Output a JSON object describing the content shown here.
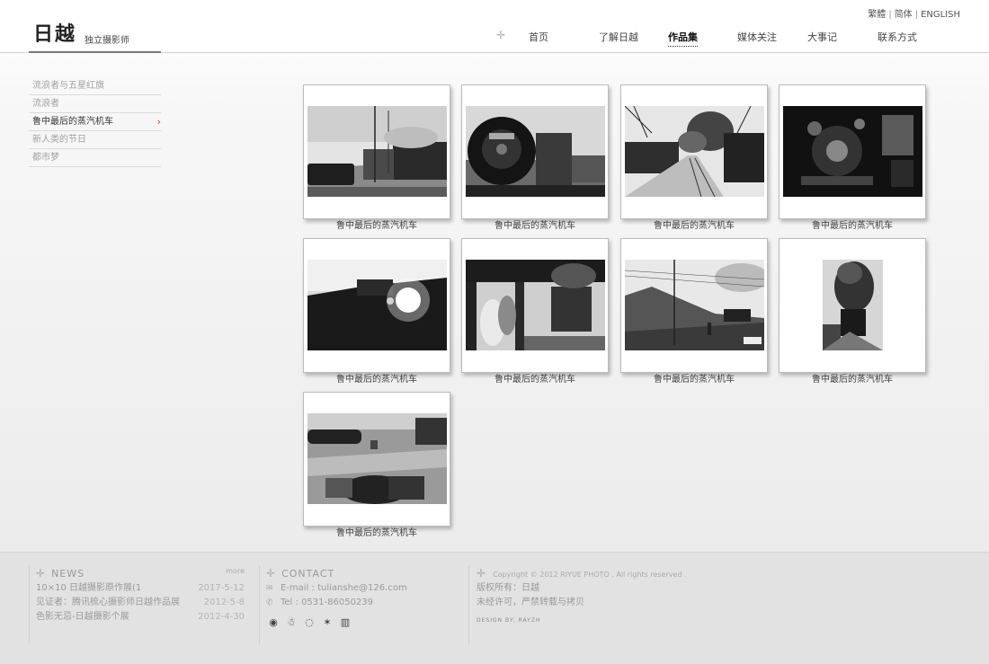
{
  "header": {
    "logo_title": "日越",
    "logo_subtitle": "独立摄影师",
    "lang": {
      "traditional": "繁體",
      "simplified": "简体",
      "english": "ENGLISH"
    },
    "nav": [
      "首页",
      "了解日越",
      "作品集",
      "媒体关注",
      "大事记",
      "联系方式"
    ],
    "nav_active": "作品集"
  },
  "sidebar": {
    "items": [
      {
        "label": "流浪者与五星红旗"
      },
      {
        "label": "流浪者"
      },
      {
        "label": "鲁中最后的蒸汽机车",
        "active": true
      },
      {
        "label": "新人类的节日"
      },
      {
        "label": "都市梦"
      }
    ],
    "arrow": "›"
  },
  "gallery": {
    "items": [
      {
        "caption": "鲁中最后的蒸汽机车"
      },
      {
        "caption": "鲁中最后的蒸汽机车"
      },
      {
        "caption": "鲁中最后的蒸汽机车"
      },
      {
        "caption": "鲁中最后的蒸汽机车"
      },
      {
        "caption": "鲁中最后的蒸汽机车"
      },
      {
        "caption": "鲁中最后的蒸汽机车"
      },
      {
        "caption": "鲁中最后的蒸汽机车"
      },
      {
        "caption": "鲁中最后的蒸汽机车"
      },
      {
        "caption": "鲁中最后的蒸汽机车"
      }
    ]
  },
  "footer": {
    "news": {
      "title": "NEWS",
      "more": "more",
      "items": [
        {
          "title": "10×10 日越摄影原作展(1",
          "date": "2017-5-12"
        },
        {
          "title": "见证者：腾讯梳心摄影师日越作品展",
          "date": "2012-5-8"
        },
        {
          "title": "色影无忌-日越摄影个展",
          "date": "2012-4-30"
        }
      ]
    },
    "contact": {
      "title": "CONTACT",
      "email": "E-mail : tulianshe@126.com",
      "tel": "Tel : 0531-86050239",
      "social_icons": [
        "weibo-icon",
        "qq-icon",
        "chat-icon",
        "star-icon",
        "chart-icon"
      ]
    },
    "copyright": {
      "line": "Copyright © 2012 RIYUE PHOTO . All rights reserved .",
      "owner": "版权所有：日越",
      "notice": "未经许可，严禁转载与拷贝",
      "design": "DESIGN BY: RAYZH"
    }
  }
}
